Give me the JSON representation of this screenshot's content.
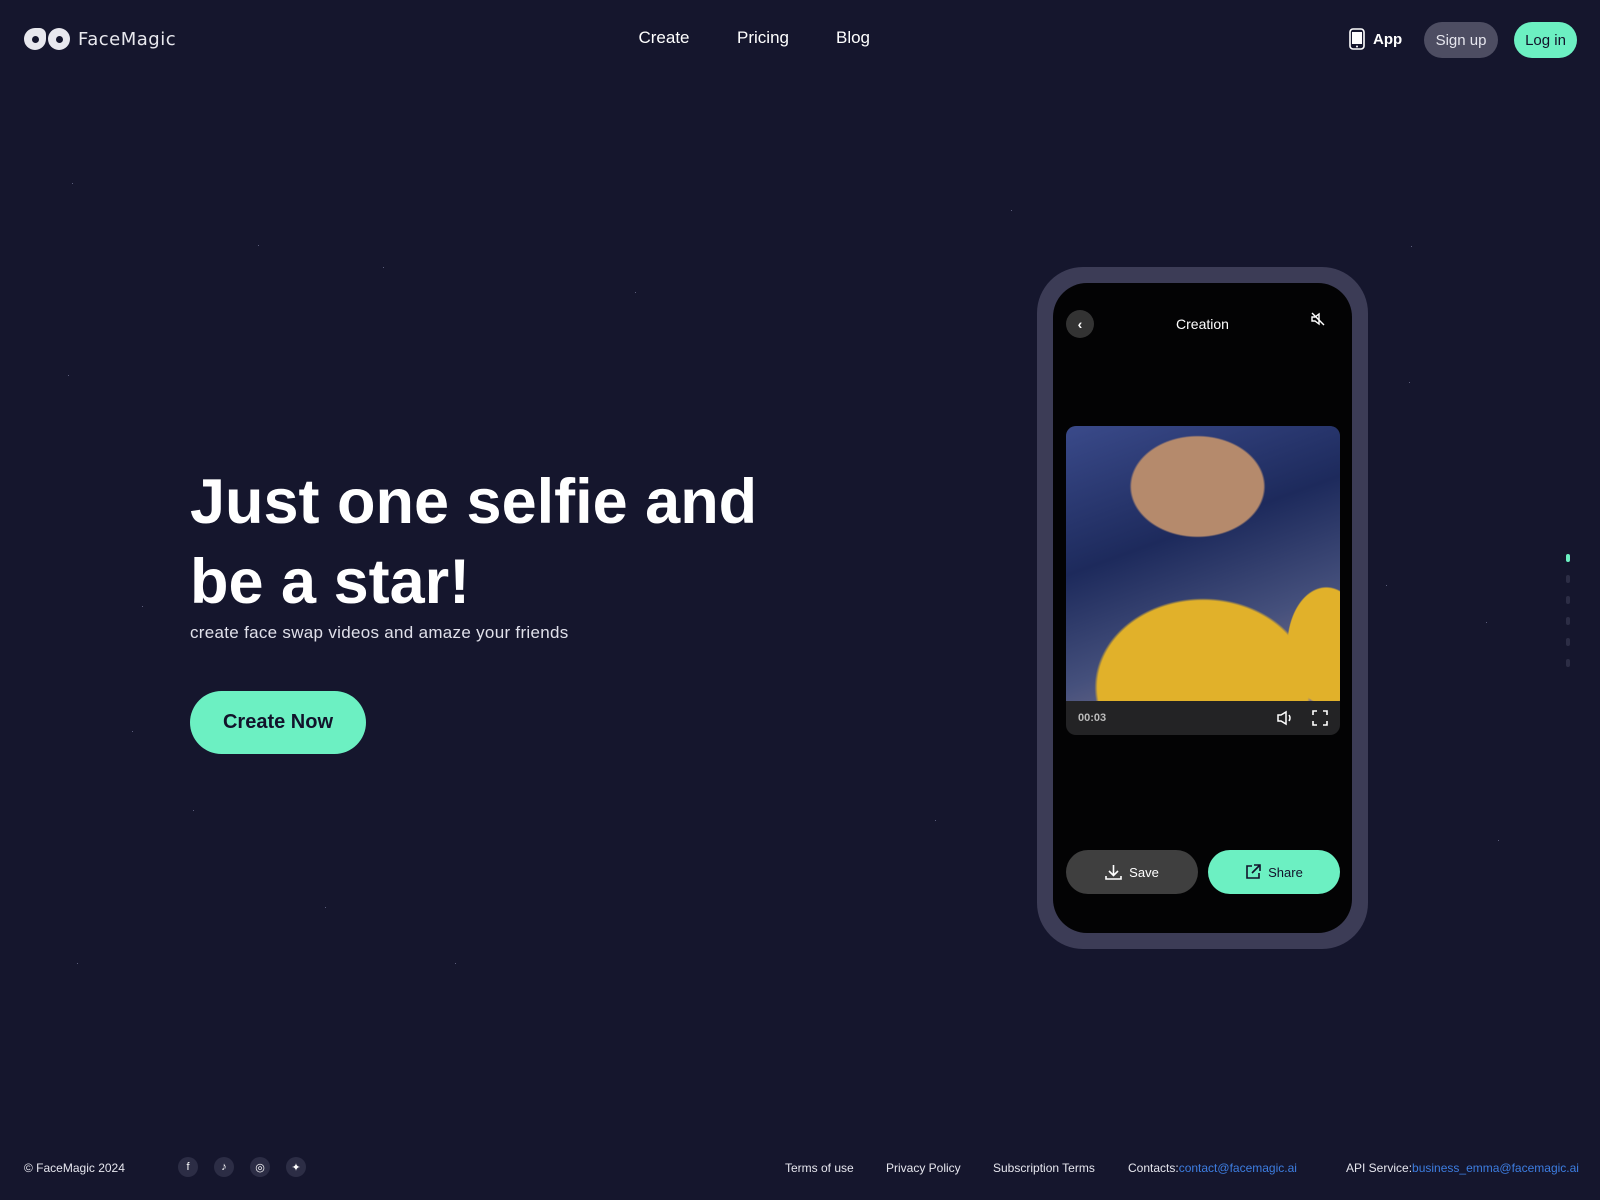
{
  "brand": {
    "name": "FaceMagic"
  },
  "nav": {
    "items": [
      "Create",
      "Pricing",
      "Blog"
    ]
  },
  "header": {
    "app_label": "App",
    "app_icon_text": "APP",
    "signup": "Sign up",
    "login": "Log in"
  },
  "hero": {
    "title_line1": "Just one selfie and",
    "title_line2": "be a star!",
    "subtitle": "create face swap videos and amaze your friends",
    "cta": "Create Now"
  },
  "phone": {
    "title": "Creation",
    "time": "00:03",
    "save": "Save",
    "share": "Share"
  },
  "pager": {
    "count": 6,
    "active": 0
  },
  "footer": {
    "copyright": "© FaceMagic 2024",
    "social": [
      "facebook-icon",
      "tiktok-icon",
      "instagram-icon",
      "twitter-icon"
    ],
    "terms": "Terms of use",
    "privacy": "Privacy Policy",
    "subscription": "Subscription Terms",
    "contacts_label": "Contacts:",
    "contacts_email": "contact@facemagic.ai",
    "api_label": "API Service:",
    "api_email": "business_emma@facemagic.ai"
  },
  "colors": {
    "background": "#15162d",
    "accent": "#6cf0c2",
    "link": "#3d7de0"
  }
}
